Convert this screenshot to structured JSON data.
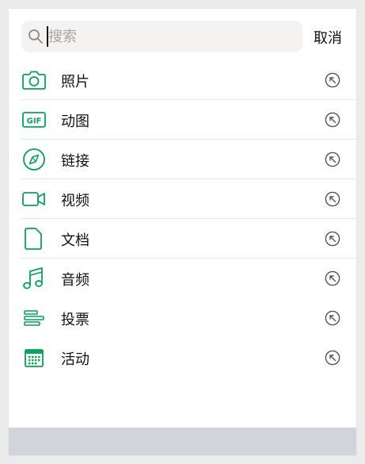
{
  "search": {
    "placeholder": "搜索",
    "value": "",
    "cancel_label": "取消"
  },
  "colors": {
    "accent": "#07a35a",
    "divider": "#e5e5e5",
    "footer": "#d1d5db"
  },
  "items": [
    {
      "label": "照片",
      "icon": "camera-icon"
    },
    {
      "label": "动图",
      "icon": "gif-icon",
      "icon_text": "GIF"
    },
    {
      "label": "链接",
      "icon": "compass-icon"
    },
    {
      "label": "视频",
      "icon": "video-camera-icon"
    },
    {
      "label": "文档",
      "icon": "document-icon"
    },
    {
      "label": "音频",
      "icon": "music-note-icon"
    },
    {
      "label": "投票",
      "icon": "poll-bars-icon"
    },
    {
      "label": "活动",
      "icon": "calendar-icon"
    }
  ]
}
